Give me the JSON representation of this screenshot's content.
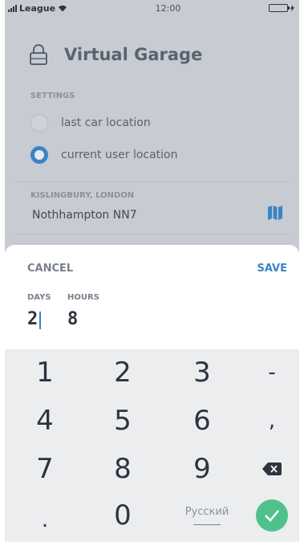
{
  "status_bar": {
    "carrier": "League",
    "time": "12:00"
  },
  "app": {
    "title": "Virtual Garage",
    "settings_label": "SETTINGS",
    "options": [
      {
        "label": "last car location",
        "selected": false
      },
      {
        "label": "current user location",
        "selected": true
      }
    ],
    "location_region": "KISLINGBURY, LONDON",
    "location_value": "Nothhampton NN7"
  },
  "sheet": {
    "cancel_label": "CANCEL",
    "save_label": "SAVE",
    "days_label": "DAYS",
    "hours_label": "HOURS",
    "days_value": "2",
    "hours_value": "8"
  },
  "keyboard": {
    "keys": [
      "1",
      "2",
      "3",
      "-",
      "4",
      "5",
      "6",
      ",",
      "7",
      "8",
      "9",
      ".",
      "0"
    ],
    "language": "Русский"
  },
  "colors": {
    "accent": "#3b83c6",
    "confirm": "#4fc18d",
    "overlay": "#c7cbd2"
  }
}
